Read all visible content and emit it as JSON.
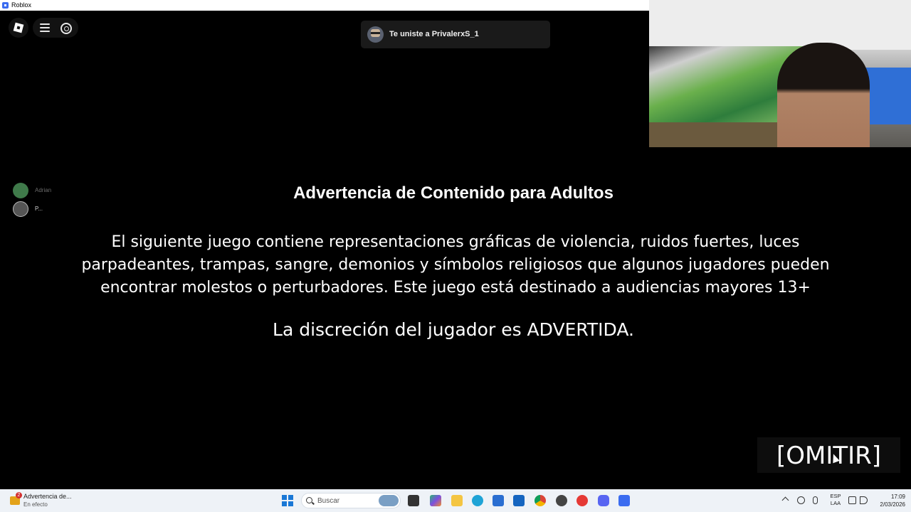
{
  "window": {
    "title": "Roblox"
  },
  "toast": {
    "text": "Te uniste a PrivalerxS_1"
  },
  "players": [
    {
      "name": "Adrian"
    },
    {
      "name": "P..."
    }
  ],
  "warning": {
    "title": "Advertencia de Contenido para Adultos",
    "body": "El siguiente juego contiene representaciones gráficas de violencia, ruidos fuertes, luces parpadeantes, trampas, sangre, demonios y símbolos religiosos que algunos jugadores pueden encontrar molestos o perturbadores. Este juego está destinado a audiencias mayores 13+",
    "note": "La discreción del jugador es ADVERTIDA."
  },
  "skip_button": {
    "label": "[OMITIR]"
  },
  "taskbar": {
    "notification": {
      "badge": "2",
      "title": "Advertencia de...",
      "subtitle": "En efecto"
    },
    "search_placeholder": "Buscar",
    "apps": [
      "file-explorer-icon",
      "copilot-icon",
      "folder-icon",
      "edge-icon",
      "store-icon",
      "outlook-icon",
      "chrome-icon",
      "game-icon",
      "opera-icon",
      "discord-icon",
      "roblox-icon"
    ],
    "tray": {
      "lang_line1": "ESP",
      "lang_line2": "LAA",
      "time": "17:09",
      "date": "2/03/2026"
    }
  },
  "colors": {
    "background": "#000000",
    "taskbar": "#eef2f7",
    "toast_bg": "#1a1a1a",
    "accent_blue": "#1a78d6"
  }
}
